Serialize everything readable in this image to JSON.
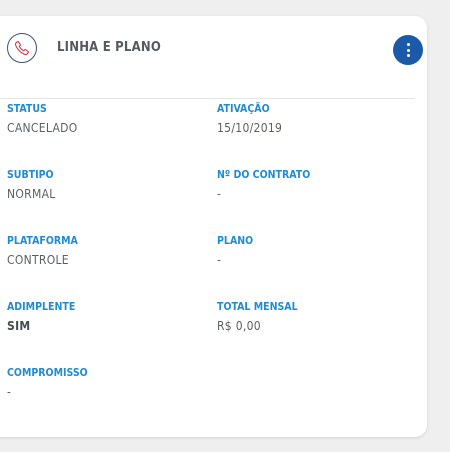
{
  "card": {
    "title": "LINHA E PLANO",
    "icon": "phone-icon",
    "menu_icon": "more-vertical-icon",
    "accent_color": "#1f8bd0",
    "menu_button_color": "#1a5aa8",
    "fields": [
      {
        "label": "STATUS",
        "value": "CANCELADO"
      },
      {
        "label": "ATIVAÇÃO",
        "value": "15/10/2019"
      },
      {
        "label": "SUBTIPO",
        "value": "NORMAL"
      },
      {
        "label": "Nº DO CONTRATO",
        "value": "-"
      },
      {
        "label": "PLATAFORMA",
        "value": "CONTROLE"
      },
      {
        "label": "PLANO",
        "value": "-"
      },
      {
        "label": "ADIMPLENTE",
        "value": "SIM"
      },
      {
        "label": "TOTAL MENSAL",
        "value": "R$ 0,00"
      },
      {
        "label": "COMPROMISSO",
        "value": "-"
      }
    ]
  }
}
